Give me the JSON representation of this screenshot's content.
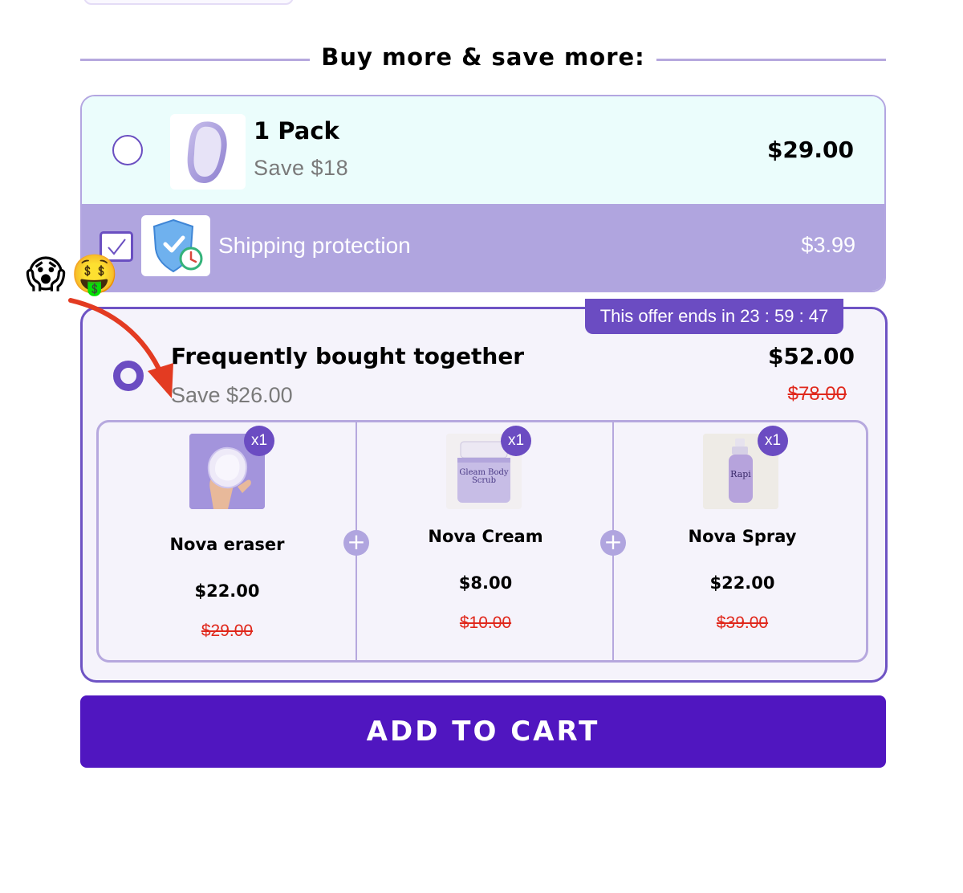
{
  "heading": {
    "text": "Buy more & save more:"
  },
  "offer_single": {
    "title": "1 Pack",
    "save": "Save $18",
    "price": "$29.00",
    "selected": false
  },
  "shipping_protection": {
    "label": "Shipping protection",
    "price": "$3.99",
    "checked": true,
    "icon": "shield-clock-icon"
  },
  "emojis": {
    "scream": "😱",
    "money_mouth": "🤑"
  },
  "offer_bundle": {
    "timer": "This offer ends in 23 : 59 : 47",
    "title": "Frequently bought together",
    "save": "Save $26.00",
    "price": "$52.00",
    "original_price": "$78.00",
    "selected": true,
    "products": [
      {
        "name": "Nova eraser",
        "price": "$22.00",
        "original_price": "$29.00",
        "qty": "x1"
      },
      {
        "name": "Nova Cream",
        "price": "$8.00",
        "original_price": "$10.00",
        "qty": "x1",
        "jar_label": "Gleam Body Scrub"
      },
      {
        "name": "Nova Spray",
        "price": "$22.00",
        "original_price": "$39.00",
        "qty": "x1",
        "bottle_label": "Rapi"
      }
    ]
  },
  "cta": {
    "label": "ADD TO CART"
  },
  "colors": {
    "accent": "#6b4cc2",
    "cta": "#5016c0",
    "strike": "#e0281c",
    "shipping_bg": "#b0a5df",
    "option1_bg": "#ebfdfc"
  }
}
